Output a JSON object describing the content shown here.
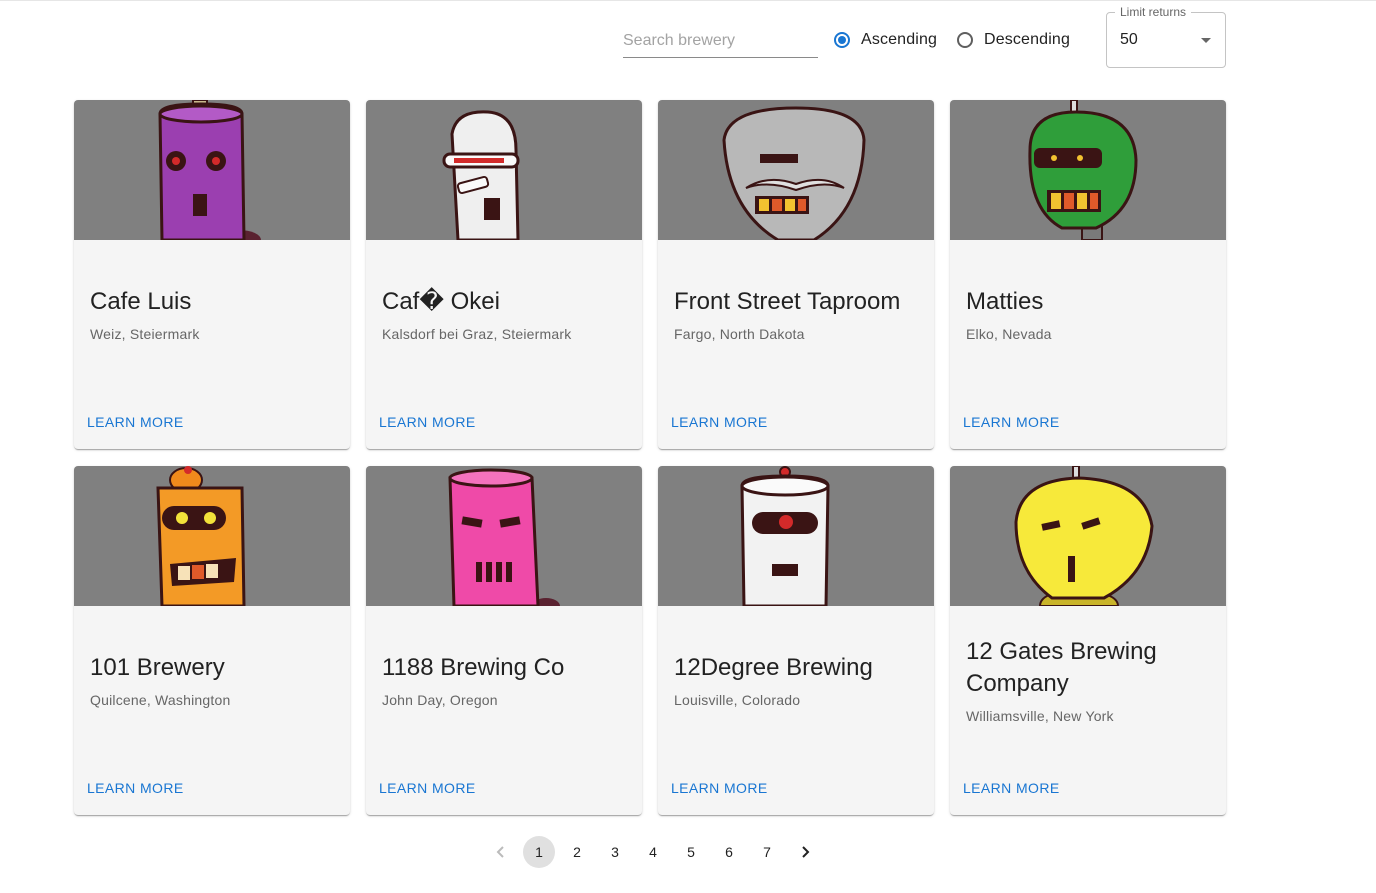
{
  "search": {
    "placeholder": "Search brewery",
    "value": ""
  },
  "sort": {
    "options": [
      {
        "label": "Ascending",
        "checked": true
      },
      {
        "label": "Descending",
        "checked": false
      }
    ]
  },
  "limit": {
    "label": "Limit returns",
    "value": "50"
  },
  "colors": {
    "accent": "#1976d2",
    "media_bg": "#808080",
    "card_bg": "#f5f5f5"
  },
  "cards": [
    {
      "name": "Cafe Luis",
      "location": "Weiz, Steiermark",
      "action": "LEARN MORE",
      "robot": "purple-robot-icon"
    },
    {
      "name": "Caf� Okei",
      "location": "Kalsdorf bei Graz, Steiermark",
      "action": "LEARN MORE",
      "robot": "white-robot-icon"
    },
    {
      "name": "Front Street Taproom",
      "location": "Fargo, North Dakota",
      "action": "LEARN MORE",
      "robot": "grey-robot-icon"
    },
    {
      "name": "Matties",
      "location": "Elko, Nevada",
      "action": "LEARN MORE",
      "robot": "green-robot-icon"
    },
    {
      "name": "101 Brewery",
      "location": "Quilcene, Washington",
      "action": "LEARN MORE",
      "robot": "orange-robot-icon"
    },
    {
      "name": "1188 Brewing Co",
      "location": "John Day, Oregon",
      "action": "LEARN MORE",
      "robot": "pink-robot-icon"
    },
    {
      "name": "12Degree Brewing",
      "location": "Louisville, Colorado",
      "action": "LEARN MORE",
      "robot": "white-red-eye-robot-icon"
    },
    {
      "name": "12 Gates Brewing Company",
      "location": "Williamsville, New York",
      "action": "LEARN MORE",
      "robot": "yellow-robot-icon"
    }
  ],
  "pagination": {
    "pages": [
      "1",
      "2",
      "3",
      "4",
      "5",
      "6",
      "7"
    ],
    "current": "1",
    "prev_icon": "chevron-left-icon",
    "next_icon": "chevron-right-icon"
  }
}
